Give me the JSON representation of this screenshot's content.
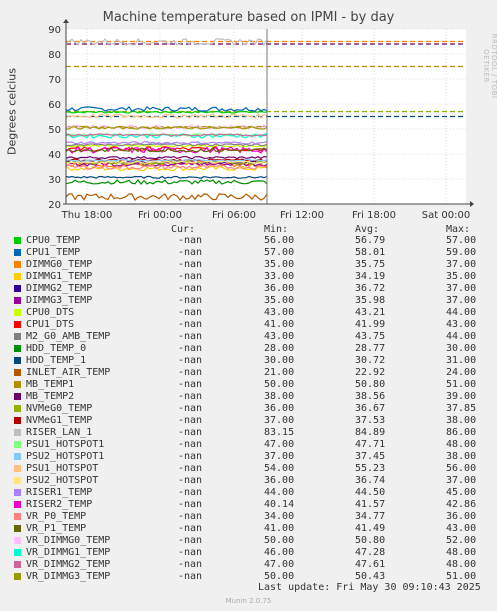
{
  "title": "Machine temperature based on IPMI - by day",
  "rrdtool_label": "RRDTOOL / TOBI OETIKER",
  "munin_version": "Munin 2.0.75",
  "last_update": "Last update: Fri May 30 09:10:43 2025",
  "legend_headers": {
    "cur": "Cur:",
    "min": "Min:",
    "avg": "Avg:",
    "max": "Max:"
  },
  "chart_data": {
    "type": "line",
    "title": "Machine temperature based on IPMI - by day",
    "ylabel": "Degrees celcius",
    "xlabel": "",
    "ylim": [
      20,
      90
    ],
    "yticks": [
      20,
      30,
      40,
      50,
      60,
      70,
      80,
      90
    ],
    "xticks": [
      "Thu 18:00",
      "Fri 00:00",
      "Fri 06:00",
      "Fri 12:00",
      "Fri 18:00",
      "Sat 00:00"
    ],
    "grid": true,
    "data_end_label": "Fri 09:10",
    "series": [
      {
        "name": "CPU0_TEMP",
        "color": "#00cc00",
        "cur": "-nan",
        "min": "56.00",
        "avg": "56.79",
        "max": "57.00"
      },
      {
        "name": "CPU1_TEMP",
        "color": "#0066b3",
        "cur": "-nan",
        "min": "57.00",
        "avg": "58.01",
        "max": "59.00"
      },
      {
        "name": "DIMMG0_TEMP",
        "color": "#ff8000",
        "cur": "-nan",
        "min": "35.00",
        "avg": "35.75",
        "max": "37.00"
      },
      {
        "name": "DIMMG1_TEMP",
        "color": "#ffcc00",
        "cur": "-nan",
        "min": "33.00",
        "avg": "34.19",
        "max": "35.00"
      },
      {
        "name": "DIMMG2_TEMP",
        "color": "#330099",
        "cur": "-nan",
        "min": "36.00",
        "avg": "36.72",
        "max": "37.00"
      },
      {
        "name": "DIMMG3_TEMP",
        "color": "#990099",
        "cur": "-nan",
        "min": "35.00",
        "avg": "35.98",
        "max": "37.00"
      },
      {
        "name": "CPU0_DTS",
        "color": "#ccff00",
        "cur": "-nan",
        "min": "43.00",
        "avg": "43.21",
        "max": "44.00"
      },
      {
        "name": "CPU1_DTS",
        "color": "#ff0000",
        "cur": "-nan",
        "min": "41.00",
        "avg": "41.99",
        "max": "43.00"
      },
      {
        "name": "M2_G0_AMB_TEMP",
        "color": "#808080",
        "cur": "-nan",
        "min": "43.00",
        "avg": "43.75",
        "max": "44.00"
      },
      {
        "name": "HDD_TEMP_0",
        "color": "#008f00",
        "cur": "-nan",
        "min": "28.00",
        "avg": "28.77",
        "max": "30.00"
      },
      {
        "name": "HDD_TEMP_1",
        "color": "#00487d",
        "cur": "-nan",
        "min": "30.00",
        "avg": "30.72",
        "max": "31.00"
      },
      {
        "name": "INLET_AIR_TEMP",
        "color": "#b35a00",
        "cur": "-nan",
        "min": "21.00",
        "avg": "22.92",
        "max": "24.00"
      },
      {
        "name": "MB_TEMP1",
        "color": "#b38f00",
        "cur": "-nan",
        "min": "50.00",
        "avg": "50.80",
        "max": "51.00"
      },
      {
        "name": "MB_TEMP2",
        "color": "#6b006b",
        "cur": "-nan",
        "min": "38.00",
        "avg": "38.56",
        "max": "39.00"
      },
      {
        "name": "NVMeG0_TEMP",
        "color": "#8fb300",
        "cur": "-nan",
        "min": "36.00",
        "avg": "36.67",
        "max": "37.85"
      },
      {
        "name": "NVMeG1_TEMP",
        "color": "#b30000",
        "cur": "-nan",
        "min": "37.00",
        "avg": "37.53",
        "max": "38.00"
      },
      {
        "name": "RISER_LAN_1",
        "color": "#bebebe",
        "cur": "-nan",
        "min": "83.15",
        "avg": "84.89",
        "max": "86.00"
      },
      {
        "name": "PSU1_HOTSPOT1",
        "color": "#80ff80",
        "cur": "-nan",
        "min": "47.00",
        "avg": "47.71",
        "max": "48.00"
      },
      {
        "name": "PSU2_HOTSPOT1",
        "color": "#80c9ff",
        "cur": "-nan",
        "min": "37.00",
        "avg": "37.45",
        "max": "38.00"
      },
      {
        "name": "PSU1_HOTSPOT",
        "color": "#ffc080",
        "cur": "-nan",
        "min": "54.00",
        "avg": "55.23",
        "max": "56.00"
      },
      {
        "name": "PSU2_HOTSPOT",
        "color": "#ffe680",
        "cur": "-nan",
        "min": "36.00",
        "avg": "36.74",
        "max": "37.00"
      },
      {
        "name": "RISER1_TEMP",
        "color": "#aa80ff",
        "cur": "-nan",
        "min": "44.00",
        "avg": "44.50",
        "max": "45.00"
      },
      {
        "name": "RISER2_TEMP",
        "color": "#ee00cc",
        "cur": "-nan",
        "min": "40.14",
        "avg": "41.57",
        "max": "42.86"
      },
      {
        "name": "VR_P0_TEMP",
        "color": "#ff8080",
        "cur": "-nan",
        "min": "34.00",
        "avg": "34.77",
        "max": "36.00"
      },
      {
        "name": "VR_P1_TEMP",
        "color": "#666600",
        "cur": "-nan",
        "min": "41.00",
        "avg": "41.49",
        "max": "43.00"
      },
      {
        "name": "VR_DIMMG0_TEMP",
        "color": "#ffbfff",
        "cur": "-nan",
        "min": "50.00",
        "avg": "50.80",
        "max": "52.00"
      },
      {
        "name": "VR_DIMMG1_TEMP",
        "color": "#00ffcc",
        "cur": "-nan",
        "min": "46.00",
        "avg": "47.28",
        "max": "48.00"
      },
      {
        "name": "VR_DIMMG2_TEMP",
        "color": "#cc6699",
        "cur": "-nan",
        "min": "47.00",
        "avg": "47.61",
        "max": "48.00"
      },
      {
        "name": "VR_DIMMG3_TEMP",
        "color": "#999900",
        "cur": "-nan",
        "min": "50.00",
        "avg": "50.43",
        "max": "51.00"
      }
    ],
    "thresholds": [
      {
        "value": 85,
        "color": "#ff8000"
      },
      {
        "value": 84,
        "color": "#6b006b"
      },
      {
        "value": 75,
        "color": "#b38f00"
      },
      {
        "value": 57,
        "color": "#8fb300"
      },
      {
        "value": 55,
        "color": "#00487d"
      }
    ]
  }
}
